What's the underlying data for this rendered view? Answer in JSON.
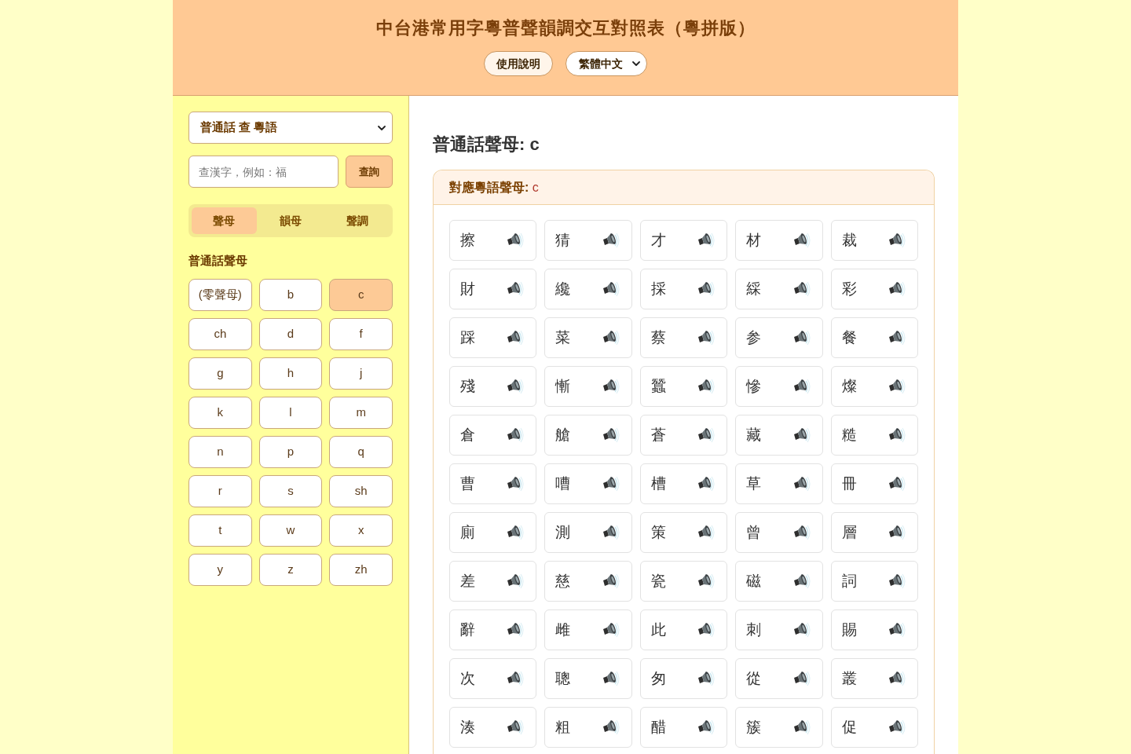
{
  "header": {
    "title": "中台港常用字粵普聲韻調交互對照表（粵拼版）",
    "help_button": "使用說明",
    "language_select": "繁體中文"
  },
  "sidebar": {
    "mode_select": "普通話 查 粵語",
    "search": {
      "placeholder": "查漢字，例如：福",
      "button": "查詢"
    },
    "tabs": [
      {
        "label": "聲母",
        "selected": true
      },
      {
        "label": "韻母",
        "selected": false
      },
      {
        "label": "聲調",
        "selected": false
      }
    ],
    "section_title": "普通話聲母",
    "initials": [
      {
        "label": "(零聲母)",
        "selected": false
      },
      {
        "label": "b",
        "selected": false
      },
      {
        "label": "c",
        "selected": true
      },
      {
        "label": "ch",
        "selected": false
      },
      {
        "label": "d",
        "selected": false
      },
      {
        "label": "f",
        "selected": false
      },
      {
        "label": "g",
        "selected": false
      },
      {
        "label": "h",
        "selected": false
      },
      {
        "label": "j",
        "selected": false
      },
      {
        "label": "k",
        "selected": false
      },
      {
        "label": "l",
        "selected": false
      },
      {
        "label": "m",
        "selected": false
      },
      {
        "label": "n",
        "selected": false
      },
      {
        "label": "p",
        "selected": false
      },
      {
        "label": "q",
        "selected": false
      },
      {
        "label": "r",
        "selected": false
      },
      {
        "label": "s",
        "selected": false
      },
      {
        "label": "sh",
        "selected": false
      },
      {
        "label": "t",
        "selected": false
      },
      {
        "label": "w",
        "selected": false
      },
      {
        "label": "x",
        "selected": false
      },
      {
        "label": "y",
        "selected": false
      },
      {
        "label": "z",
        "selected": false
      },
      {
        "label": "zh",
        "selected": false
      }
    ]
  },
  "main": {
    "heading": "普通話聲母: c",
    "card": {
      "label": "對應粵語聲母:",
      "value": "c",
      "characters": [
        "擦",
        "猜",
        "才",
        "材",
        "裁",
        "財",
        "纔",
        "採",
        "綵",
        "彩",
        "踩",
        "菜",
        "蔡",
        "参",
        "餐",
        "殘",
        "慚",
        "蠶",
        "慘",
        "燦",
        "倉",
        "艙",
        "蒼",
        "藏",
        "糙",
        "曹",
        "嘈",
        "槽",
        "草",
        "冊",
        "廁",
        "測",
        "策",
        "曾",
        "層",
        "差",
        "慈",
        "瓷",
        "磁",
        "詞",
        "辭",
        "雌",
        "此",
        "刺",
        "賜",
        "次",
        "聰",
        "匆",
        "從",
        "叢",
        "湊",
        "粗",
        "醋",
        "簇",
        "促"
      ]
    }
  }
}
